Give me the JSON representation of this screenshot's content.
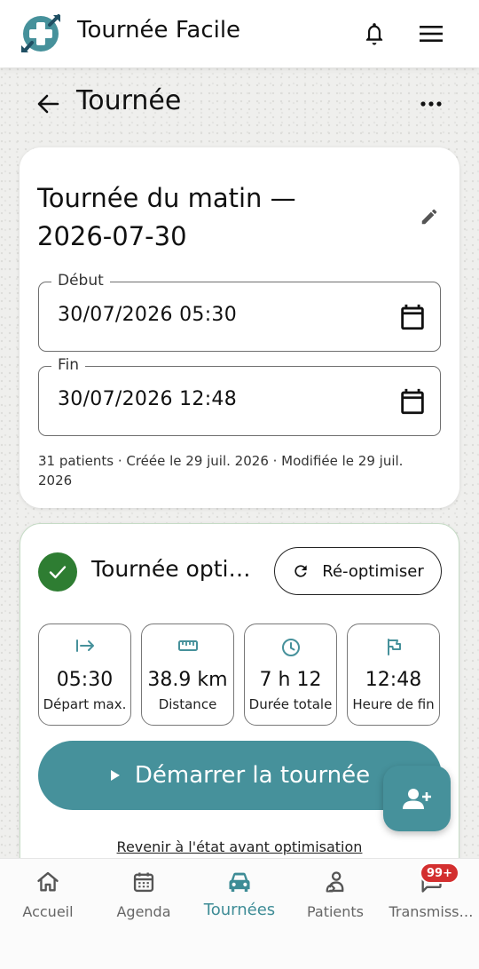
{
  "app": {
    "title": "Tournée Facile",
    "brand_color": "#46919b",
    "success_color": "#2e7d32",
    "icons": {
      "logo": "medical-cross-logo",
      "notifications": "bell-icon",
      "menu": "hamburger-menu-icon"
    }
  },
  "page": {
    "title": "Tournée",
    "back_icon": "arrow-left-icon",
    "more_icon": "more-horizontal-icon"
  },
  "tour": {
    "name": "Tournée du matin — 2026-07-30",
    "edit_icon": "pencil-icon",
    "start_field": {
      "label": "Début",
      "value": "30/07/2026 05:30"
    },
    "end_field": {
      "label": "Fin",
      "value": "30/07/2026 12:48"
    },
    "meta": "31 patients · Créée le 29 juil. 2026 · Modifiée le 29 juil. 2026"
  },
  "optimization": {
    "status_title": "Tournée optimisée",
    "reoptimize_label": "Ré-optimiser",
    "stats": [
      {
        "icon": "departure-arrow-icon",
        "value": "05:30",
        "label": "Départ max."
      },
      {
        "icon": "ruler-icon",
        "value": "38.9 km",
        "label": "Distance"
      },
      {
        "icon": "clock-icon",
        "value": "7 h 12",
        "label": "Durée totale"
      },
      {
        "icon": "flag-icon",
        "value": "12:48",
        "label": "Heure de fin"
      }
    ],
    "start_button": "Démarrer la tournée",
    "revert_link": "Revenir à l'état avant optimisation"
  },
  "fab": {
    "icon": "add-person-icon"
  },
  "nav": {
    "items": [
      {
        "label": "Accueil",
        "icon": "home-icon",
        "active": false
      },
      {
        "label": "Agenda",
        "icon": "calendar-icon",
        "active": false
      },
      {
        "label": "Tournées",
        "icon": "car-icon",
        "active": true
      },
      {
        "label": "Patients",
        "icon": "patient-icon",
        "active": false
      },
      {
        "label": "Transmiss…",
        "icon": "chat-icon",
        "active": false
      }
    ],
    "badge": "99+"
  }
}
